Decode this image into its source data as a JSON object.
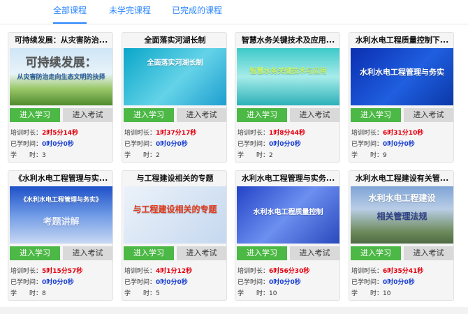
{
  "tabs": [
    {
      "label": "全部课程",
      "active": true
    },
    {
      "label": "未学完课程",
      "active": false
    },
    {
      "label": "已完成的课程",
      "active": false
    }
  ],
  "labels": {
    "learn": "进入学习",
    "exam": "进入考试",
    "train_time": "培训时长：",
    "studied_time": "已学时间：",
    "hours": "学　　时："
  },
  "courses": [
    {
      "title": "可持续发展：从灾害防治...",
      "thumb_text": "可持续发展：",
      "thumb_sub": "从灾害防治走向生态文明的抉择",
      "train": "2时5分14秒",
      "studied": "0时0分0秒",
      "hours": "3"
    },
    {
      "title": "全面落实河湖长制",
      "thumb_text": "全面落实河湖长制",
      "thumb_sub": "",
      "train": "1时37分17秒",
      "studied": "0时0分0秒",
      "hours": "2"
    },
    {
      "title": "智慧水务关键技术及应用...",
      "thumb_text": "智慧水务关键技术与应用",
      "thumb_sub": "",
      "train": "1时8分44秒",
      "studied": "0时0分0秒",
      "hours": "2"
    },
    {
      "title": "水利水电工程质量控制下...",
      "thumb_text": "水利水电工程管理与务实",
      "thumb_sub": "",
      "train": "6时31分10秒",
      "studied": "0时0分0秒",
      "hours": "9"
    },
    {
      "title": "《水利水电工程管理与实...",
      "thumb_text": "《水利水电工程管理与务实》",
      "thumb_sub": "考题讲解",
      "train": "5时15分57秒",
      "studied": "0时0分0秒",
      "hours": "8"
    },
    {
      "title": "与工程建设相关的专题",
      "thumb_text": "与工程建设相关的专题",
      "thumb_sub": "",
      "train": "4时1分12秒",
      "studied": "0时0分0秒",
      "hours": "5"
    },
    {
      "title": "水利水电工程管理与实务...",
      "thumb_text": "水利水电工程质量控制",
      "thumb_sub": "",
      "train": "6时56分30秒",
      "studied": "0时0分0秒",
      "hours": "10"
    },
    {
      "title": "水利水电工程建设有关管...",
      "thumb_text": "水利水电工程建设",
      "thumb_sub": "相关管理法规",
      "train": "6时35分41秒",
      "studied": "0时0分0秒",
      "hours": "10"
    }
  ],
  "colors": {
    "accent": "#2a86ff",
    "learn_button": "#4cb845",
    "exam_button": "#d9d9d9",
    "train_value": "#e4000f",
    "studied_value": "#1a3fd0"
  }
}
